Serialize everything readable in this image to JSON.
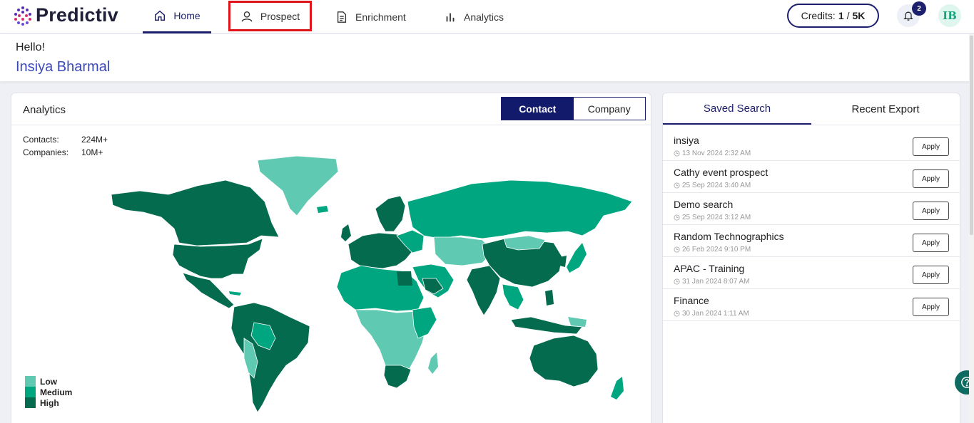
{
  "header": {
    "logo_text": "Predictiv",
    "nav": [
      {
        "label": "Home",
        "icon": "home-icon"
      },
      {
        "label": "Prospect",
        "icon": "user-icon"
      },
      {
        "label": "Enrichment",
        "icon": "document-icon"
      },
      {
        "label": "Analytics",
        "icon": "bar-chart-icon"
      }
    ],
    "credits_label": "Credits:",
    "credits_used": "1",
    "credits_sep": "/",
    "credits_total": "5K",
    "notifications_count": "2",
    "avatar_initials": "IB"
  },
  "greeting": {
    "hello": "Hello!",
    "name": "Insiya Bharmal"
  },
  "analytics": {
    "title": "Analytics",
    "toggle": {
      "contact": "Contact",
      "company": "Company",
      "active": "Contact"
    },
    "stats": [
      {
        "label": "Contacts:",
        "value": "224M+"
      },
      {
        "label": "Companies:",
        "value": "10M+"
      }
    ],
    "legend": [
      {
        "label": "Low",
        "color": "#5fcab1"
      },
      {
        "label": "Medium",
        "color": "#00a680"
      },
      {
        "label": "High",
        "color": "#046b4f"
      }
    ]
  },
  "saved_panel": {
    "tabs": [
      {
        "label": "Saved Search"
      },
      {
        "label": "Recent Export"
      }
    ],
    "active_tab": "Saved Search",
    "apply_label": "Apply",
    "items": [
      {
        "name": "insiya",
        "date": "13 Nov 2024 2:32 AM"
      },
      {
        "name": "Cathy event prospect",
        "date": "25 Sep 2024 3:40 AM"
      },
      {
        "name": "Demo search",
        "date": "25 Sep 2024 3:12 AM"
      },
      {
        "name": "Random Technographics",
        "date": "26 Feb 2024 9:10 PM"
      },
      {
        "name": "APAC - Training",
        "date": "31 Jan 2024 8:07 AM"
      },
      {
        "name": "Finance",
        "date": "30 Jan 2024 1:11 AM"
      }
    ]
  },
  "colors": {
    "brand": "#1c1f6b",
    "highlight": "#e0141b",
    "accent_name": "#3b49b8"
  }
}
